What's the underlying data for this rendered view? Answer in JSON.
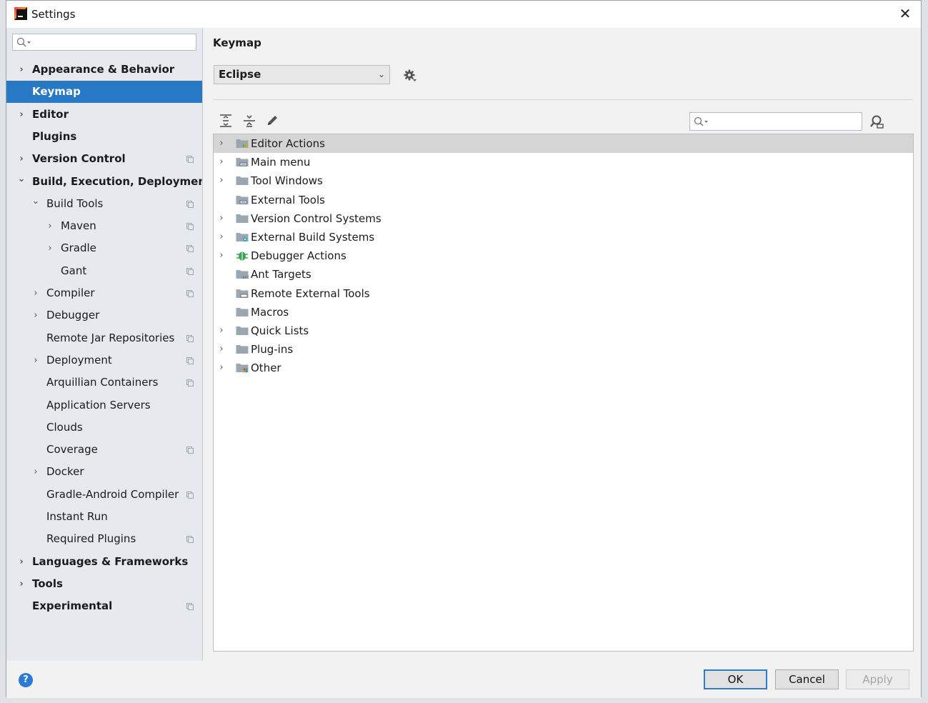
{
  "window": {
    "title": "Settings",
    "close_glyph": "✕"
  },
  "sidebar": {
    "search": {
      "placeholder": "",
      "icon": "search-icon"
    },
    "items": [
      {
        "label": "Appearance & Behavior",
        "level": 0,
        "bold": true,
        "expander": "collapsed",
        "project_icon": false
      },
      {
        "label": "Keymap",
        "level": 0,
        "bold": true,
        "expander": "none",
        "project_icon": false,
        "selected": true
      },
      {
        "label": "Editor",
        "level": 0,
        "bold": true,
        "expander": "collapsed",
        "project_icon": false
      },
      {
        "label": "Plugins",
        "level": 0,
        "bold": true,
        "expander": "none",
        "project_icon": false
      },
      {
        "label": "Version Control",
        "level": 0,
        "bold": true,
        "expander": "collapsed",
        "project_icon": true
      },
      {
        "label": "Build, Execution, Deployment",
        "level": 0,
        "bold": true,
        "expander": "expanded",
        "project_icon": false
      },
      {
        "label": "Build Tools",
        "level": 1,
        "bold": false,
        "expander": "expanded",
        "project_icon": true
      },
      {
        "label": "Maven",
        "level": 2,
        "bold": false,
        "expander": "collapsed",
        "project_icon": true
      },
      {
        "label": "Gradle",
        "level": 2,
        "bold": false,
        "expander": "collapsed",
        "project_icon": true
      },
      {
        "label": "Gant",
        "level": 2,
        "bold": false,
        "expander": "none",
        "project_icon": true
      },
      {
        "label": "Compiler",
        "level": 1,
        "bold": false,
        "expander": "collapsed",
        "project_icon": true
      },
      {
        "label": "Debugger",
        "level": 1,
        "bold": false,
        "expander": "collapsed",
        "project_icon": false
      },
      {
        "label": "Remote Jar Repositories",
        "level": 1,
        "bold": false,
        "expander": "none",
        "project_icon": true
      },
      {
        "label": "Deployment",
        "level": 1,
        "bold": false,
        "expander": "collapsed",
        "project_icon": true
      },
      {
        "label": "Arquillian Containers",
        "level": 1,
        "bold": false,
        "expander": "none",
        "project_icon": true
      },
      {
        "label": "Application Servers",
        "level": 1,
        "bold": false,
        "expander": "none",
        "project_icon": false
      },
      {
        "label": "Clouds",
        "level": 1,
        "bold": false,
        "expander": "none",
        "project_icon": false
      },
      {
        "label": "Coverage",
        "level": 1,
        "bold": false,
        "expander": "none",
        "project_icon": true
      },
      {
        "label": "Docker",
        "level": 1,
        "bold": false,
        "expander": "collapsed",
        "project_icon": false
      },
      {
        "label": "Gradle-Android Compiler",
        "level": 1,
        "bold": false,
        "expander": "none",
        "project_icon": true
      },
      {
        "label": "Instant Run",
        "level": 1,
        "bold": false,
        "expander": "none",
        "project_icon": false
      },
      {
        "label": "Required Plugins",
        "level": 1,
        "bold": false,
        "expander": "none",
        "project_icon": true
      },
      {
        "label": "Languages & Frameworks",
        "level": 0,
        "bold": true,
        "expander": "collapsed",
        "project_icon": false
      },
      {
        "label": "Tools",
        "level": 0,
        "bold": true,
        "expander": "collapsed",
        "project_icon": false
      },
      {
        "label": "Experimental",
        "level": 0,
        "bold": true,
        "expander": "none",
        "project_icon": true
      }
    ]
  },
  "main": {
    "title": "Keymap",
    "scheme": {
      "value": "Eclipse"
    },
    "toolbar": [
      "expand-all-icon",
      "collapse-all-icon",
      "edit-icon"
    ],
    "search": {
      "placeholder": ""
    },
    "actions": [
      {
        "label": "Editor Actions",
        "expander": true,
        "icon": "editor-actions-folder",
        "selected": true
      },
      {
        "label": "Main menu",
        "expander": true,
        "icon": "main-menu-folder"
      },
      {
        "label": "Tool Windows",
        "expander": true,
        "icon": "folder"
      },
      {
        "label": "External Tools",
        "expander": false,
        "icon": "external-tools-folder"
      },
      {
        "label": "Version Control Systems",
        "expander": true,
        "icon": "folder"
      },
      {
        "label": "External Build Systems",
        "expander": true,
        "icon": "build-systems-folder"
      },
      {
        "label": "Debugger Actions",
        "expander": true,
        "icon": "bug-icon"
      },
      {
        "label": "Ant Targets",
        "expander": false,
        "icon": "ant-folder"
      },
      {
        "label": "Remote External Tools",
        "expander": false,
        "icon": "remote-tools-folder"
      },
      {
        "label": "Macros",
        "expander": false,
        "icon": "folder"
      },
      {
        "label": "Quick Lists",
        "expander": true,
        "icon": "folder"
      },
      {
        "label": "Plug-ins",
        "expander": true,
        "icon": "folder"
      },
      {
        "label": "Other",
        "expander": true,
        "icon": "other-folder"
      }
    ]
  },
  "footer": {
    "help": "?",
    "ok": "OK",
    "cancel": "Cancel",
    "apply": "Apply"
  },
  "colors": {
    "selection": "#2779c6",
    "tree_selection": "#d5d5d5",
    "help": "#2b7bd4"
  }
}
